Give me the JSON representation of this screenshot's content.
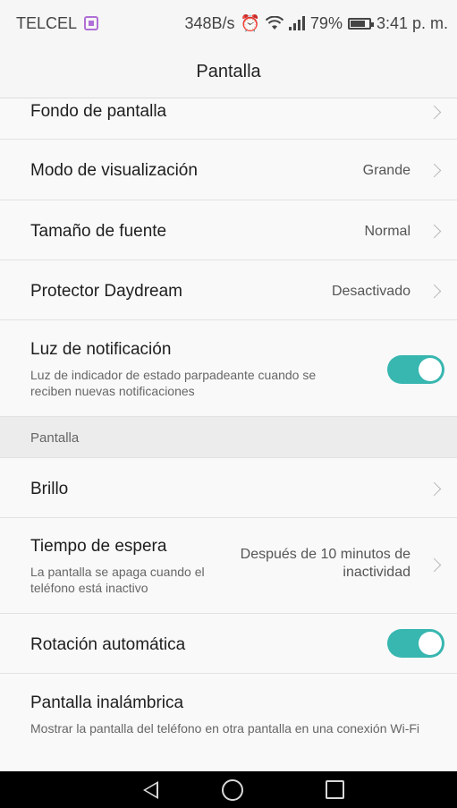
{
  "status_bar": {
    "carrier": "TELCEL",
    "net_speed": "348B/s",
    "battery": "79%",
    "time": "3:41 p. m."
  },
  "header": {
    "title": "Pantalla"
  },
  "settings": {
    "wallpaper": {
      "title": "Fondo de pantalla"
    },
    "display_mode": {
      "title": "Modo de visualización",
      "value": "Grande"
    },
    "font_size": {
      "title": "Tamaño de fuente",
      "value": "Normal"
    },
    "daydream": {
      "title": "Protector Daydream",
      "value": "Desactivado"
    },
    "notification_light": {
      "title": "Luz de notificación",
      "desc": "Luz de indicador de estado parpadeante cuando se reciben nuevas notificaciones",
      "enabled": true
    },
    "section_label": "Pantalla",
    "brightness": {
      "title": "Brillo"
    },
    "sleep": {
      "title": "Tiempo de espera",
      "desc": "La pantalla se apaga cuando el teléfono está inactivo",
      "value": "Después de 10 minutos de inactividad"
    },
    "auto_rotate": {
      "title": "Rotación automática",
      "enabled": true
    },
    "wireless_display": {
      "title": "Pantalla inalámbrica",
      "desc": "Mostrar la pantalla del teléfono en otra pantalla en una conexión Wi-Fi"
    }
  },
  "colors": {
    "accent": "#38b6b0",
    "nav_bar": "#000000"
  },
  "icons": [
    "alarm-icon",
    "wifi-icon",
    "signal-icon",
    "battery-icon",
    "chevron-right-icon",
    "nav-back-icon",
    "nav-home-icon",
    "nav-recents-icon"
  ]
}
